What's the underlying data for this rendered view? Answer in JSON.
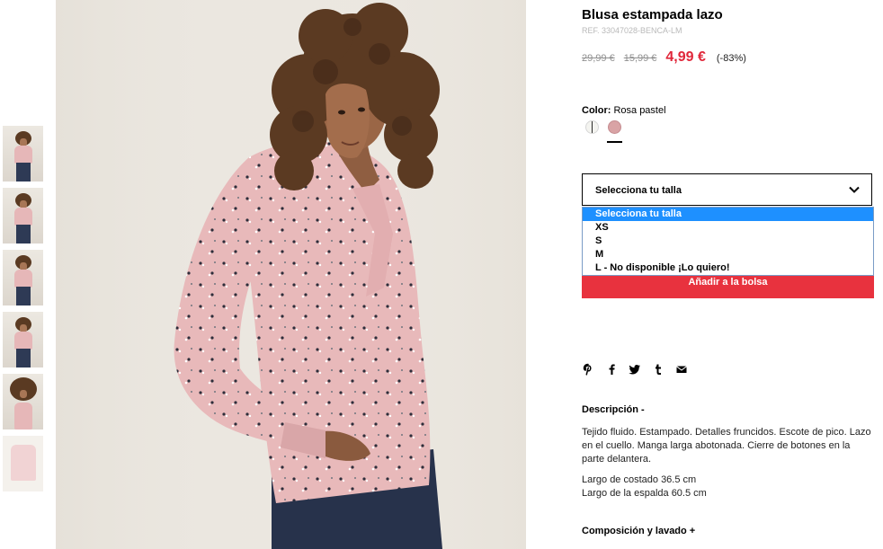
{
  "product": {
    "title": "Blusa estampada lazo",
    "ref": "REF. 33047028-BENCA-LM",
    "price_original": "29,99 €",
    "price_previous": "15,99 €",
    "price_current": "4,99 €",
    "discount": "(-83%)"
  },
  "color": {
    "label": "Color:",
    "value": "Rosa pastel",
    "swatches": [
      "white-print-swatch",
      "pink-swatch"
    ],
    "selected_index": 1
  },
  "size": {
    "placeholder": "Selecciona tu talla",
    "options": [
      "Selecciona tu talla",
      "XS",
      "S",
      "M",
      "L - No disponible ¡Lo quiero!"
    ],
    "highlighted_index": 0
  },
  "actions": {
    "add_to_bag": "Añadir a la bolsa"
  },
  "share_icons": [
    "pinterest-icon",
    "facebook-icon",
    "twitter-icon",
    "tumblr-icon",
    "email-icon"
  ],
  "description": {
    "heading": "Descripción -",
    "text": "Tejido fluido. Estampado. Detalles fruncidos. Escote de pico. Lazo en el cuello. Manga larga abotonada. Cierre de botones en la parte delantera.",
    "measure_1": "Largo de costado 36.5 cm",
    "measure_2": "Largo de la espalda 60.5 cm"
  },
  "composition": {
    "heading": "Composición y lavado +"
  },
  "thumbnails_count": 6,
  "colors": {
    "price_accent": "#e0273a",
    "button_bg": "#e8323e",
    "dropdown_highlight": "#1e90ff",
    "blouse_pink": "#e6b7b8"
  }
}
